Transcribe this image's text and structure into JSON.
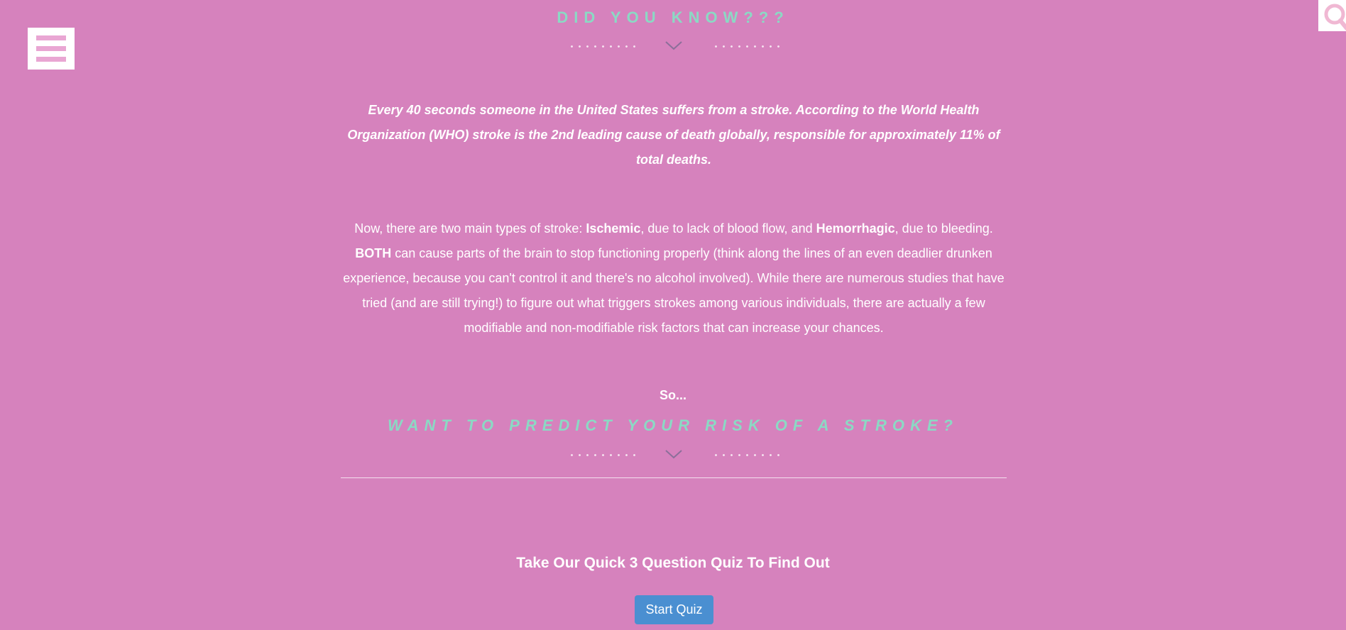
{
  "header": {
    "menu_icon": "hamburger-menu-icon",
    "search_icon": "search-icon"
  },
  "did_you_know": {
    "title": "DID YOU KNOW???",
    "divider_icon": "chevron-down-icon"
  },
  "intro": {
    "text": "Every 40 seconds someone in the United States suffers from a stroke. According to the World Health Organization (WHO) stroke is the 2nd leading cause of death globally, responsible for approximately 11% of total deaths."
  },
  "body": {
    "p1": "Now, there are two main types of stroke: ",
    "ischemic": "Ischemic",
    "p2": ", due to lack of blood flow, and ",
    "hemorrhagic": "Hemorrhagic",
    "p3": ", due to bleeding. ",
    "both": "BOTH",
    "p4": " can cause parts of the brain to stop functioning properly (think along the lines of an even deadlier drunken experience, because you can't control it and there's no alcohol involved). While there are numerous studies that have tried (and are still trying!) to figure out what triggers strokes among various individuals, there are actually a few modifiable and non-modifiable risk factors that can increase your chances."
  },
  "predict": {
    "so": "So...",
    "title": "WANT TO PREDICT YOUR RISK OF A STROKE?"
  },
  "quiz": {
    "title": "Take Our Quick 3 Question Quiz To Find Out",
    "button_label": "Start Quiz"
  },
  "colors": {
    "background": "#d682bd",
    "accent_heading": "#8bd9c4",
    "button": "#4a8fd1",
    "menu_bars": "#e9a6d3",
    "search_glyph": "#f0b8d3"
  }
}
